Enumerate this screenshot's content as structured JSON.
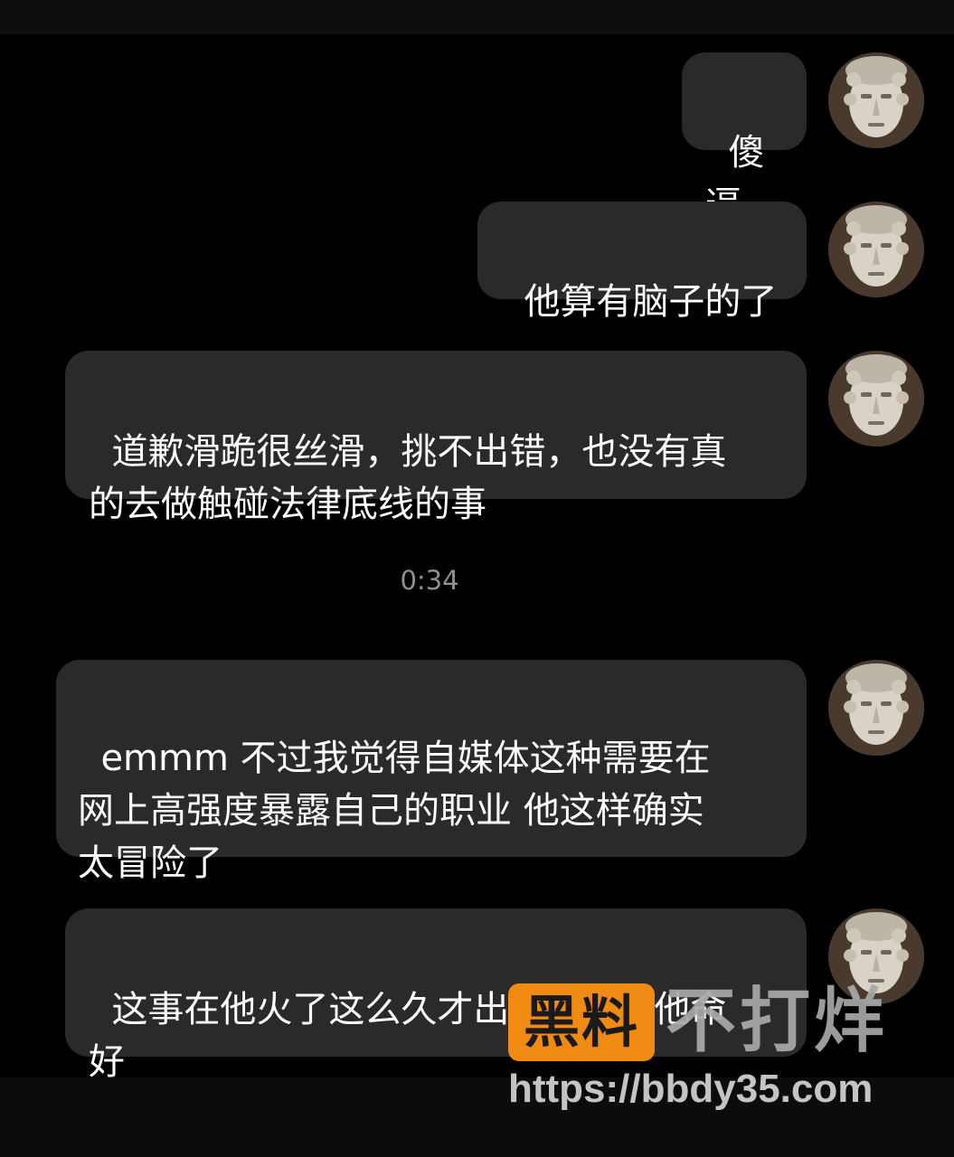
{
  "messages": [
    {
      "text": "傻逼"
    },
    {
      "text": "他算有脑子的了"
    },
    {
      "text": "道歉滑跪很丝滑，挑不出错，也没有真\n的去做触碰法律底线的事"
    },
    {
      "text": "emmm 不过我觉得自媒体这种需要在\n网上高强度暴露自己的职业 他这样确实\n太冒险了"
    },
    {
      "text": "这事在他火了这么久才出来只能说他命\n好"
    }
  ],
  "timestamp": "0:34",
  "watermark": {
    "badge": "黑料",
    "text": "不打烊",
    "url": "https://bbdy35.com",
    "badge_color": "#ef8a12"
  },
  "colors": {
    "background": "#000000",
    "bubble": "#2a2a2c",
    "text": "#ffffff",
    "timestamp": "#8e8e93"
  },
  "avatar_icon": "statue-head-icon"
}
